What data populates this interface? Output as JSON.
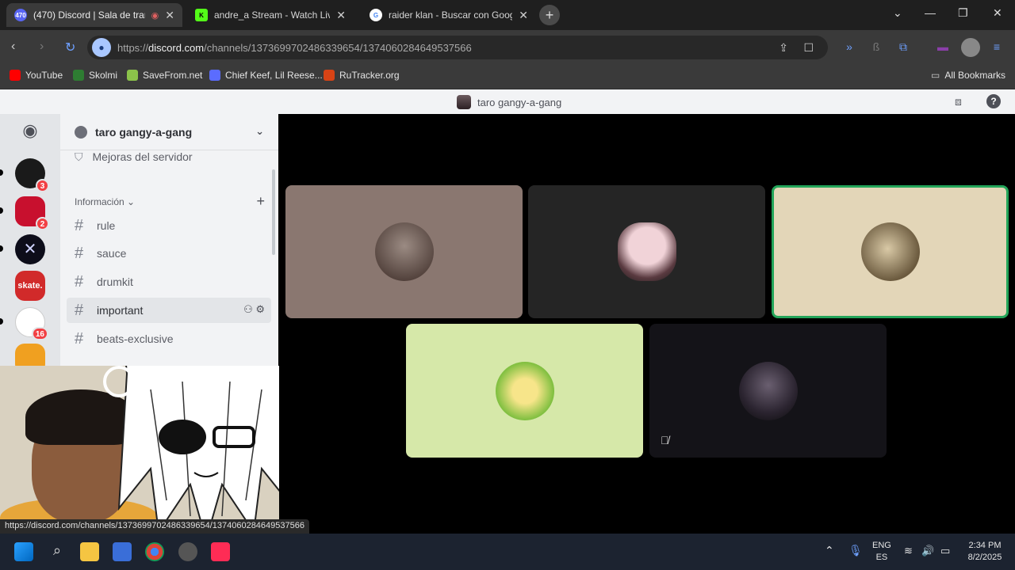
{
  "browser": {
    "tabs": [
      {
        "title": "(470) Discord | Sala de trans",
        "fav_text": "470",
        "fav_color": "#5865f2",
        "active": true
      },
      {
        "title": "andre_a Stream - Watch Live o",
        "fav_text": "K",
        "fav_color": "#53fc18",
        "active": false
      },
      {
        "title": "raider klan - Buscar con Googl",
        "fav_text": "G",
        "fav_color": "#ffffff",
        "active": false
      }
    ],
    "url_prefix": "https://",
    "url_domain": "discord.com",
    "url_path": "/channels/1373699702486339654/1374060284649537566",
    "bookmarks": [
      {
        "label": "YouTube",
        "color": "#ff0000"
      },
      {
        "label": "Skolmi",
        "color": "#2e7d32"
      },
      {
        "label": "SaveFrom.net",
        "color": "#8bc34a"
      },
      {
        "label": "Chief Keef, Lil Reese...",
        "color": "#5b6cff"
      },
      {
        "label": "RuTracker.org",
        "color": "#d84315"
      }
    ],
    "all_bookmarks": "All Bookmarks",
    "status_url": "https://discord.com/channels/1373699702486339654/1374060284649537566"
  },
  "discord": {
    "window_title": "taro gangy-a-gang",
    "server_name": "taro gangy-a-gang",
    "boost_label": "Mejoras del servidor",
    "category": "Información",
    "channels": [
      {
        "name": "rule"
      },
      {
        "name": "sauce"
      },
      {
        "name": "drumkit"
      },
      {
        "name": "important"
      },
      {
        "name": "beats-exclusive"
      }
    ],
    "guild_badges": [
      "3",
      "2",
      "",
      "",
      "16",
      ""
    ],
    "guild_colors": [
      "#1a1a1a",
      "#c8102e",
      "#0d0d1a",
      "#d12a2a",
      "#ffffff",
      "#f0a020"
    ],
    "guild_pill": [
      true,
      true,
      true,
      false,
      true,
      false
    ],
    "tiles": [
      {
        "bg": "#8a7770",
        "avatar": "#3b2a25",
        "speaking": false,
        "muted": false
      },
      {
        "bg": "#252525",
        "avatar": "#f1d3d8",
        "speaking": false,
        "muted": false
      },
      {
        "bg": "#e3d6b8",
        "avatar": "#6b5a3e",
        "speaking": true,
        "muted": false
      },
      {
        "bg": "#d6e8a9",
        "avatar": "#7fbf3f",
        "speaking": false,
        "muted": false
      },
      {
        "bg": "#141318",
        "avatar": "#2b2430",
        "speaking": false,
        "muted": true
      }
    ]
  },
  "taskbar": {
    "lang_top": "ENG",
    "lang_bottom": "ES",
    "time": "2:34 PM",
    "date": "8/2/2025"
  }
}
